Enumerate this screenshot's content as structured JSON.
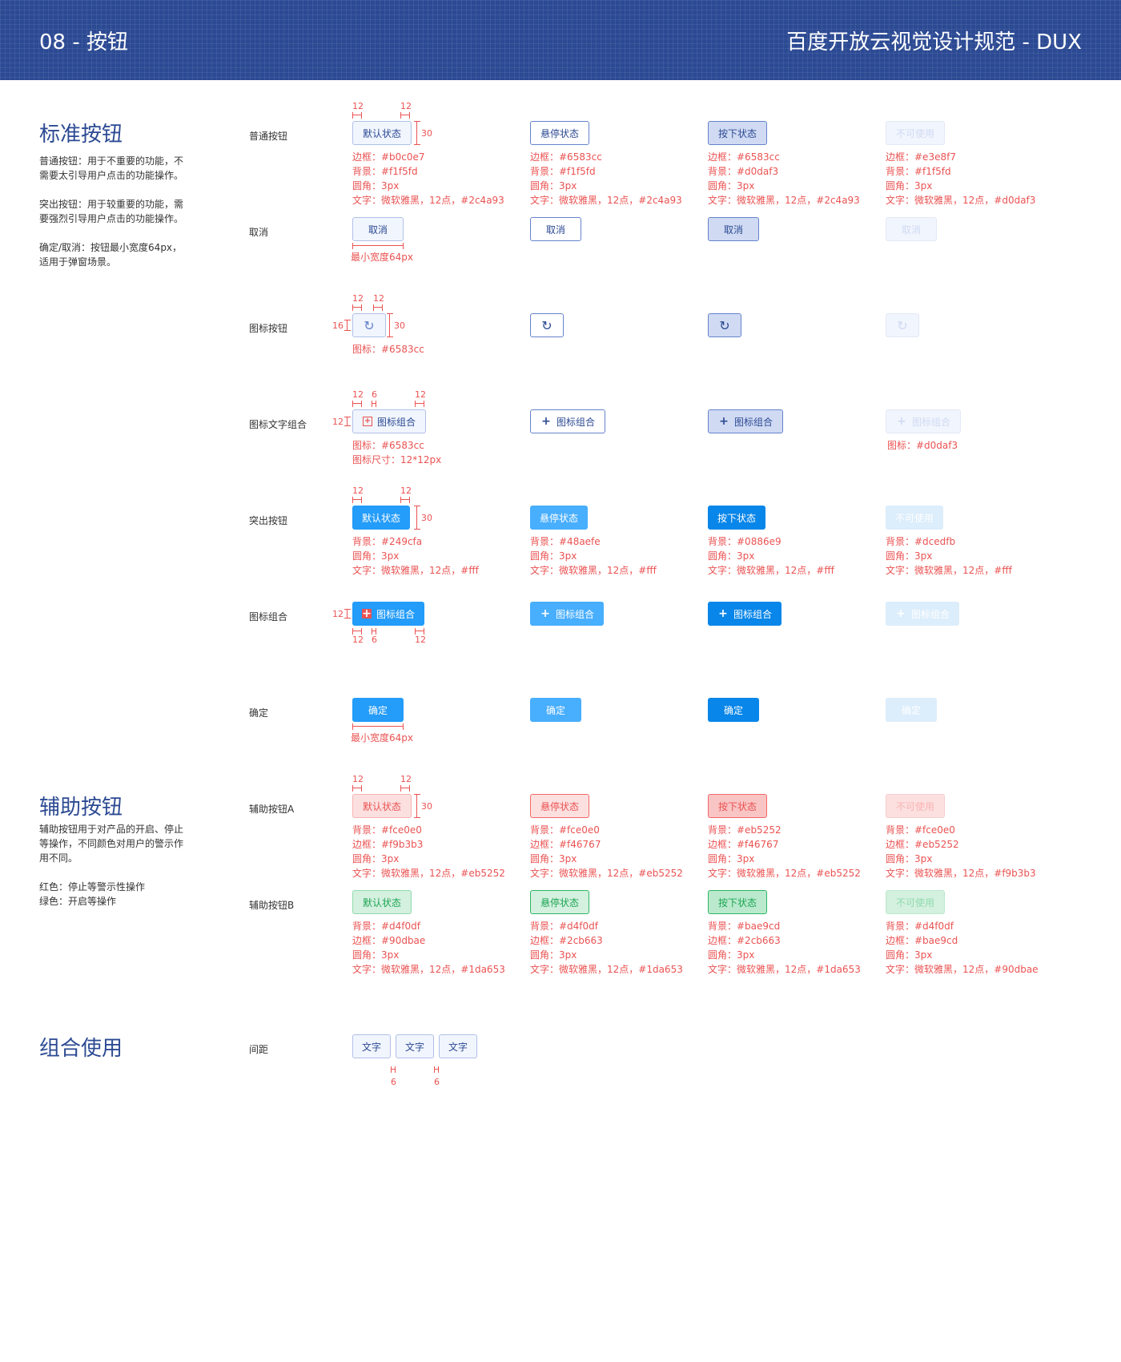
{
  "header": {
    "left": "08 - 按钮",
    "right": "百度开放云视觉设计规范 - DUX"
  },
  "sections": {
    "standard": {
      "title": "标准按钮",
      "desc": [
        "普通按钮：用于不重要的功能，不需要太引导用户点击的功能操作。",
        "突出按钮：用于较重要的功能，需要强烈引导用户点击的功能操作。",
        "确定/取消：按钮最小宽度64px，适用于弹窗场景。"
      ]
    },
    "aux": {
      "title": "辅助按钮",
      "desc": [
        "辅助按钮用于对产品的开启、停止等操作，不同颜色对用户的警示作用不同。",
        "红色：停止等警示性操作\n绿色：开启等操作"
      ]
    },
    "combo": {
      "title": "组合使用"
    }
  },
  "rows": {
    "normal": "普通按钮",
    "cancel": "取消",
    "icon": "图标按钮",
    "icontext": "图标文字组合",
    "highlight": "突出按钮",
    "hicon": "图标组合",
    "ok": "确定",
    "auxA": "辅助按钮A",
    "auxB": "辅助按钮B",
    "gap": "间距"
  },
  "labels": {
    "def": "默认状态",
    "hov": "悬停状态",
    "act": "按下状态",
    "dis": "不可使用",
    "cancel": "取消",
    "combo": "图标组合",
    "ok": "确定",
    "text": "文字"
  },
  "icons": {
    "refresh": "refresh-icon",
    "plus": "plus-icon",
    "grid": "grid-icon"
  },
  "notes": {
    "normal": [
      [
        "边框：#b0c0e7",
        "背景：#f1f5fd",
        "圆角：3px",
        "文字：微软雅黑，12点，#2c4a93"
      ],
      [
        "边框：#6583cc",
        "背景：#f1f5fd",
        "圆角：3px",
        "文字：微软雅黑，12点，#2c4a93"
      ],
      [
        "边框：#6583cc",
        "背景：#d0daf3",
        "圆角：3px",
        "文字：微软雅黑，12点，#2c4a93"
      ],
      [
        "边框：#e3e8f7",
        "背景：#f1f5fd",
        "圆角：3px",
        "文字：微软雅黑，12点，#d0daf3"
      ]
    ],
    "minwidth": "最小宽度64px",
    "icon": "图标：#6583cc",
    "icontext": [
      "图标：#6583cc",
      "图标尺寸：12*12px"
    ],
    "icontext_dis": "图标：#d0daf3",
    "highlight": [
      [
        "背景：#249cfa",
        "圆角：3px",
        "文字：微软雅黑，12点，#fff"
      ],
      [
        "背景：#48aefe",
        "圆角：3px",
        "文字：微软雅黑，12点，#fff"
      ],
      [
        "背景：#0886e9",
        "圆角：3px",
        "文字：微软雅黑，12点，#fff"
      ],
      [
        "背景：#dcedfb",
        "圆角：3px",
        "文字：微软雅黑，12点，#fff"
      ]
    ],
    "auxA": [
      [
        "背景：#fce0e0",
        "边框：#f9b3b3",
        "圆角：3px",
        "文字：微软雅黑，12点，#eb5252"
      ],
      [
        "背景：#fce0e0",
        "边框：#f46767",
        "圆角：3px",
        "文字：微软雅黑，12点，#eb5252"
      ],
      [
        "背景：#eb5252",
        "边框：#f46767",
        "圆角：3px",
        "文字：微软雅黑，12点，#eb5252"
      ],
      [
        "背景：#fce0e0",
        "边框：#eb5252",
        "圆角：3px",
        "文字：微软雅黑，12点，#f9b3b3"
      ]
    ],
    "auxB": [
      [
        "背景：#d4f0df",
        "边框：#90dbae",
        "圆角：3px",
        "文字：微软雅黑，12点，#1da653"
      ],
      [
        "背景：#d4f0df",
        "边框：#2cb663",
        "圆角：3px",
        "文字：微软雅黑，12点，#1da653"
      ],
      [
        "背景：#bae9cd",
        "边框：#2cb663",
        "圆角：3px",
        "文字：微软雅黑，12点，#1da653"
      ],
      [
        "背景：#d4f0df",
        "边框：#bae9cd",
        "圆角：3px",
        "文字：微软雅黑，12点，#90dbae"
      ]
    ]
  },
  "dims": {
    "d12": "12",
    "d30": "30",
    "d16": "16",
    "d6": "6"
  },
  "colors": {
    "primary": "#2c4a93",
    "highlight": "#249cfa",
    "danger": "#eb5252",
    "success": "#1da653",
    "annot": "#eb5252"
  }
}
